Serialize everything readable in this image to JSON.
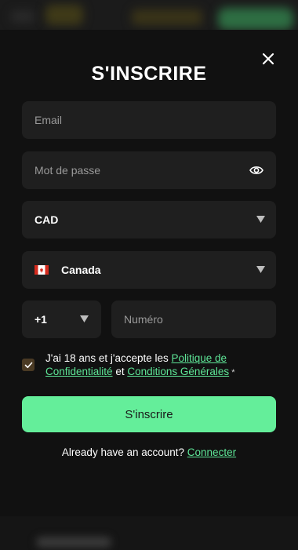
{
  "modal": {
    "title": "S'INSCRIRE",
    "email_placeholder": "Email",
    "password_placeholder": "Mot de passe",
    "currency": "CAD",
    "country": "Canada",
    "phone_code": "+1",
    "phone_placeholder": "Numéro",
    "consent": {
      "prefix": "J'ai 18 ans et j'accepte les ",
      "privacy_link": "Politique de Confidentialité",
      "middle": " et ",
      "terms_link": "Conditions Générales",
      "required_mark": " *",
      "checked": true
    },
    "submit_label": "S'inscrire",
    "login_prompt": "Already have an account? ",
    "login_link": "Connecter"
  },
  "colors": {
    "accent": "#64ee9a",
    "link": "#5ee697",
    "field_bg": "#1f1f1f",
    "modal_bg": "#111111"
  },
  "icons": {
    "close": "close-icon",
    "eye": "eye-icon",
    "caret": "caret-down-icon",
    "flag": "canada-flag-icon",
    "check": "checkmark-icon"
  }
}
